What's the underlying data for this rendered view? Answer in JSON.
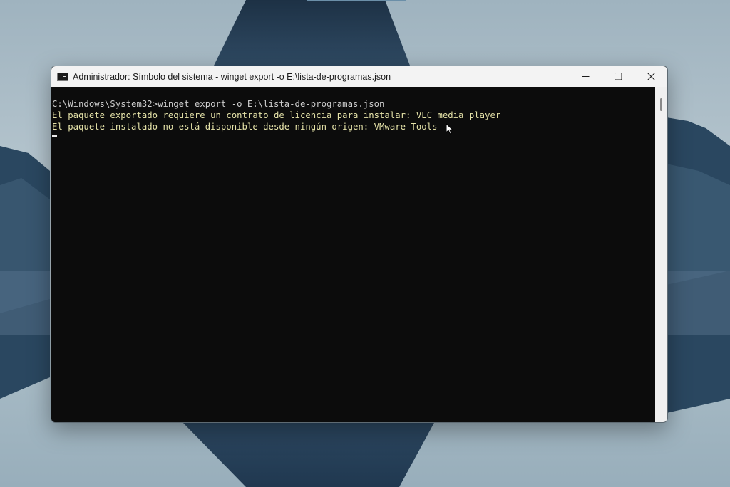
{
  "window": {
    "title": "Administrador: Símbolo del sistema - winget  export -o E:\\lista-de-programas.json",
    "icon": "cmd-icon",
    "controls": {
      "minimize": "minimize-icon",
      "maximize": "maximize-icon",
      "close": "close-icon"
    }
  },
  "console": {
    "lines": [
      "C:\\Windows\\System32>winget export -o E:\\lista-de-programas.json",
      "El paquete exportado requiere un contrato de licencia para instalar: VLC media player",
      "El paquete instalado no está disponible desde ningún origen: VMware Tools"
    ]
  },
  "colors": {
    "console_background": "#0c0c0c",
    "console_text": "#cccccc",
    "warning_text": "#e5e2a8",
    "titlebar": "#f3f3f3"
  }
}
